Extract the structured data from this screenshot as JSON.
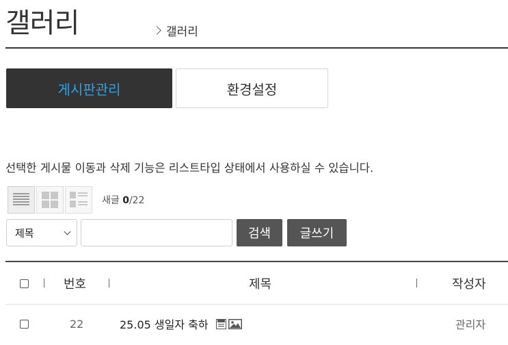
{
  "header": {
    "title": "갤러리",
    "breadcrumb_current": "갤러리"
  },
  "tabs": [
    {
      "label": "게시판관리",
      "active": true
    },
    {
      "label": "환경설정",
      "active": false
    }
  ],
  "notice": "선택한 게시물 이동과 삭제 기능은 리스트타입 상태에서 사용하실 수 있습니다.",
  "toolbar": {
    "new_posts_label": "새글",
    "new_posts_count": "0",
    "total_posts": "/22",
    "search_field_selected": "제목",
    "search_placeholder": "",
    "search_button": "검색",
    "write_button": "글쓰기"
  },
  "table": {
    "columns": {
      "number": "번호",
      "title": "제목",
      "author": "작성자"
    },
    "rows": [
      {
        "number": "22",
        "title": "25.05 생일자 축하",
        "author": "관리자"
      }
    ]
  },
  "colors": {
    "active_tab_bg": "#333333",
    "active_tab_text": "#2aa3e6",
    "button_bg": "#555555"
  },
  "icons": [
    "list-view-icon",
    "gallery-view-icon",
    "webzine-view-icon",
    "chevron-right-icon",
    "chevron-down-icon",
    "file-icon",
    "image-icon"
  ]
}
